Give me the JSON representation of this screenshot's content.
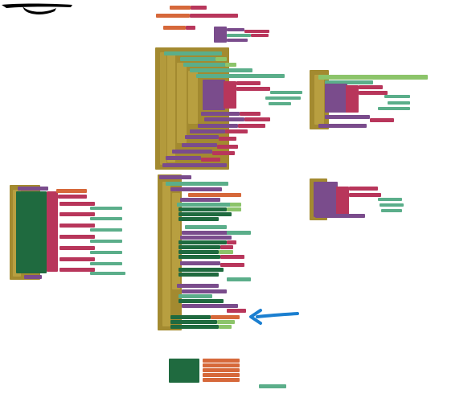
{
  "workspace": {
    "background": "#ffffff",
    "redaction_color": "#000000",
    "arrow_color": "#1b7fd0"
  },
  "palette": {
    "control": "#a38a30",
    "procedure": "#7a4c8c",
    "logic": "#b8365b",
    "text": "#d6683a",
    "component": "#5bae8a",
    "setter": "#1f6a3f",
    "math": "#8cc46a"
  },
  "blocks": {
    "header_var_1": "",
    "header_var_2": "",
    "header_var_3": "",
    "proc_a": "",
    "event_a": "",
    "event_b": "",
    "event_c": "",
    "event_d": "",
    "event_e": "",
    "setter_group": "",
    "lone_block": ""
  }
}
